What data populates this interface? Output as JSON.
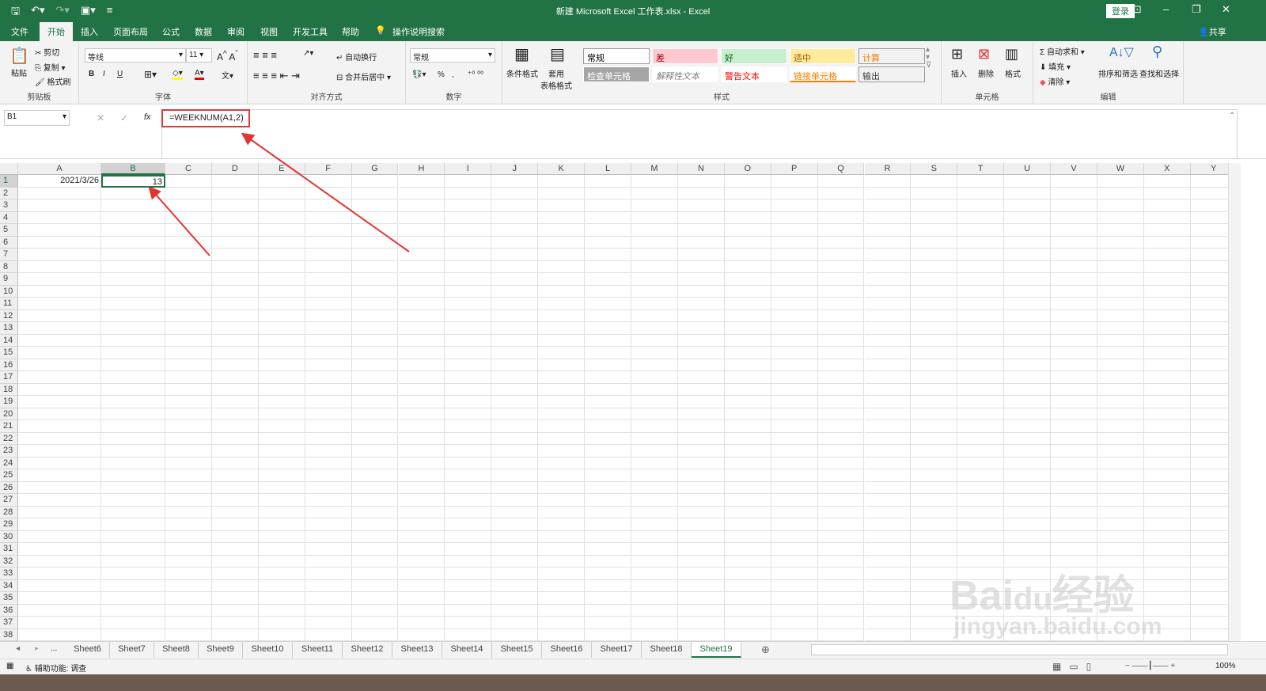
{
  "titlebar": {
    "title": "新建 Microsoft Excel 工作表.xlsx  -  Excel",
    "login": "登录",
    "minimize": "–",
    "restore": "❐",
    "close": "✕",
    "ribbon_display": "⊡"
  },
  "tabs": [
    "文件",
    "开始",
    "插入",
    "页面布局",
    "公式",
    "数据",
    "审阅",
    "视图",
    "开发工具",
    "帮助"
  ],
  "tell_me": "操作说明搜索",
  "share": "共享",
  "ribbon": {
    "clipboard": {
      "paste": "粘贴",
      "cut": "剪切",
      "copy": "复制",
      "format_painter": "格式刷",
      "label": "剪贴板"
    },
    "font": {
      "name": "等线",
      "size": "11",
      "bold": "B",
      "italic": "I",
      "underline": "U",
      "label": "字体"
    },
    "alignment": {
      "wrap": "自动换行",
      "merge": "合并后居中",
      "label": "对齐方式"
    },
    "number": {
      "format": "常规",
      "percent": "%",
      "comma": ",",
      "label": "数字"
    },
    "styles": {
      "conditional": "条件格式",
      "table": "套用\n表格格式",
      "items": [
        {
          "text": "常规",
          "bg": "#ffffff",
          "fg": "#000000"
        },
        {
          "text": "差",
          "bg": "#ffc7ce",
          "fg": "#9c0006"
        },
        {
          "text": "好",
          "bg": "#c6efce",
          "fg": "#006100"
        },
        {
          "text": "适中",
          "bg": "#ffeb9c",
          "fg": "#9c5700"
        },
        {
          "text": "计算",
          "bg": "#f2f2f2",
          "fg": "#fa7d00"
        },
        {
          "text": "检查单元格",
          "bg": "#a5a5a5",
          "fg": "#ffffff"
        },
        {
          "text": "解释性文本",
          "bg": "#ffffff",
          "fg": "#7f7f7f"
        },
        {
          "text": "警告文本",
          "bg": "#ffffff",
          "fg": "#ff0000"
        },
        {
          "text": "链接单元格",
          "bg": "#ffffff",
          "fg": "#fa7d00"
        },
        {
          "text": "输出",
          "bg": "#f2f2f2",
          "fg": "#3f3f3f"
        }
      ],
      "label": "样式"
    },
    "cells": {
      "insert": "插入",
      "delete": "删除",
      "format": "格式",
      "label": "单元格"
    },
    "editing": {
      "autosum": "自动求和",
      "fill": "填充",
      "clear": "清除",
      "sort": "排序和筛选",
      "find": "查找和选择",
      "label": "编辑"
    }
  },
  "formula_bar": {
    "name_box": "B1",
    "formula": "=WEEKNUM(A1,2)",
    "fx": "fx"
  },
  "columns": [
    "A",
    "B",
    "C",
    "D",
    "E",
    "F",
    "G",
    "H",
    "I",
    "J",
    "K",
    "L",
    "M",
    "N",
    "O",
    "P",
    "Q",
    "R",
    "S",
    "T",
    "U",
    "V",
    "W",
    "X",
    "Y"
  ],
  "row_count": 38,
  "cells": {
    "A1": "2021/3/26",
    "B1": "13"
  },
  "selected_cell": "B1",
  "sheets": [
    "Sheet6",
    "Sheet7",
    "Sheet8",
    "Sheet9",
    "Sheet10",
    "Sheet11",
    "Sheet12",
    "Sheet13",
    "Sheet14",
    "Sheet15",
    "Sheet16",
    "Sheet17",
    "Sheet18",
    "Sheet19"
  ],
  "active_sheet": "Sheet19",
  "sheet_ellipsis": "...",
  "status": {
    "accessibility": "辅助功能: 调查",
    "zoom": "100%"
  },
  "watermark": [
    "Baidu经验",
    "jingyan.baidu.com"
  ]
}
